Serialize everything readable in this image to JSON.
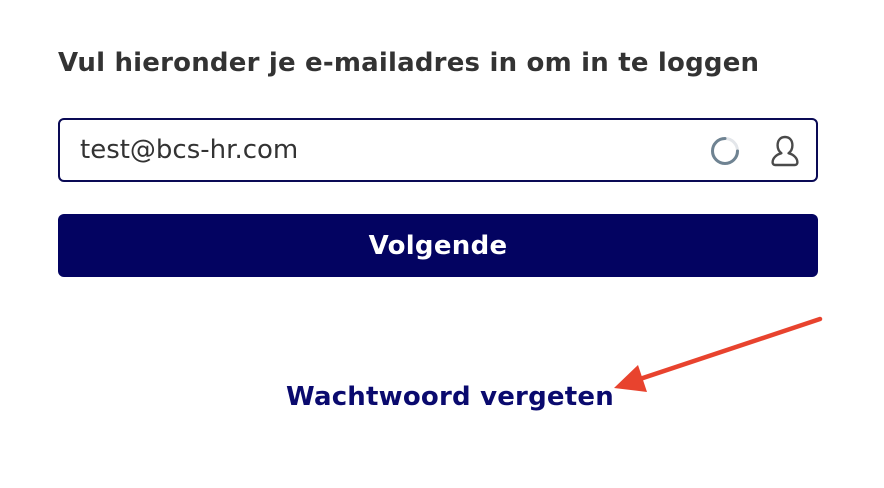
{
  "login": {
    "instruction": "Vul hieronder je e-mailadres in om in te loggen",
    "email_value": "test@bcs-hr.com",
    "email_icons": [
      "spinner-icon",
      "user-icon"
    ],
    "next_label": "Volgende",
    "forgot_label": "Wachtwoord vergeten"
  },
  "colors": {
    "primary": "#030361",
    "border": "#0a0a55",
    "link": "#0a0a6e",
    "text": "#333333",
    "annotation_arrow": "#e8432e"
  }
}
